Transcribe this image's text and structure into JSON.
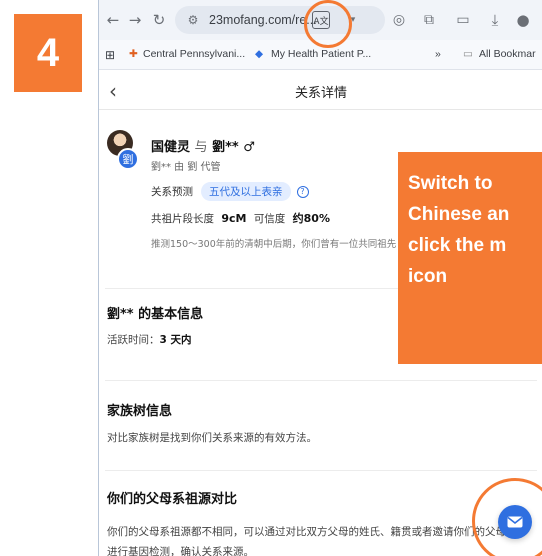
{
  "step": "4",
  "browser": {
    "url": "23mofang.com/re...",
    "bookmarks": [
      "Central Pennsylvani...",
      "My Health Patient P...",
      "»",
      "All Bookmar"
    ]
  },
  "page": {
    "title": "关系详情",
    "person": {
      "names": "国健灵",
      "conjunction": "与",
      "relative": "劉** ♂",
      "avatar_letter": "劉",
      "managed_by": "劉** 由 劉 代管"
    },
    "prediction": {
      "label": "关系预测",
      "tag": "五代及以上表亲",
      "help": "?"
    },
    "segment": {
      "label": "共祖片段长度",
      "value": "9cM",
      "confidence_label": "可信度",
      "confidence_value": "约80%"
    },
    "inference": "推测150～300年前的清朝中后期，你们曾有一位共同祖先",
    "sections": {
      "basic": {
        "title": "劉** 的基本信息",
        "active_label": "活跃时间：",
        "active_value": "3 天内"
      },
      "tree": {
        "title": "家族树信息",
        "text": "对比家族树是找到你们关系来源的有效方法。"
      },
      "parents": {
        "title": "你们的父母系祖源对比",
        "text1": "你们的父母系祖源都不相同，可以通过对比双方父母的姓氏、籍贯或者邀请你们的父母",
        "text2": "进行基因检测，确认关系来源。"
      }
    }
  },
  "callout": {
    "lines": [
      "Switch to",
      "Chinese an",
      "click the m",
      "icon"
    ]
  },
  "colors": {
    "accent_orange": "#f47a33",
    "link_blue": "#2f6fe0"
  }
}
